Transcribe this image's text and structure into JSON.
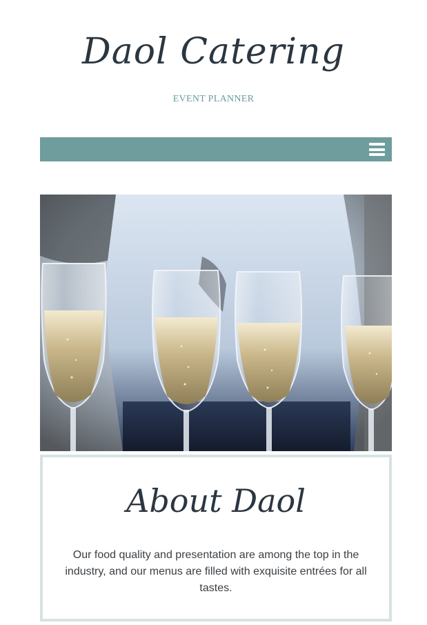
{
  "header": {
    "site_title": "Daol Catering",
    "tagline": "EVENT PLANNER"
  },
  "nav": {
    "menu_icon": "hamburger-menu-icon",
    "accent_color": "#6f9c9d"
  },
  "hero": {
    "image": "champagne-glasses-photo"
  },
  "about": {
    "title": "About Daol",
    "text": "Our food quality and presentation are among the top in the industry, and our menus are filled with exquisite entrées for all tastes.",
    "border_color": "#d6e3e3"
  }
}
